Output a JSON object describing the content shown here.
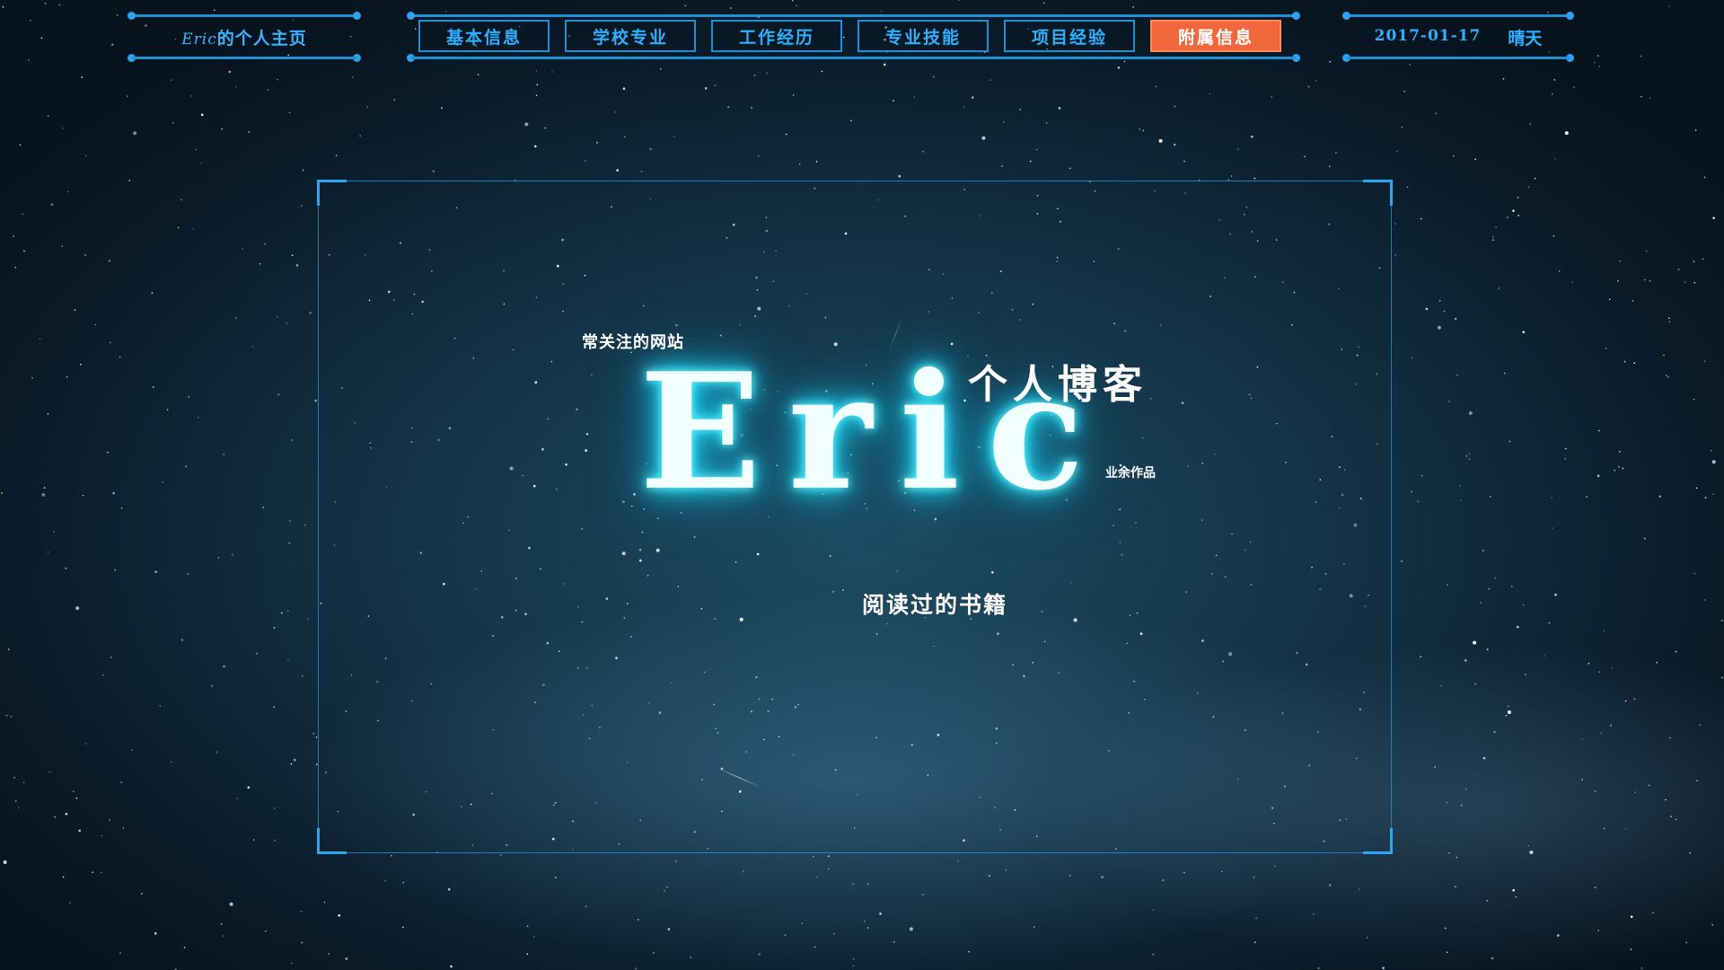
{
  "header": {
    "brand_en": "Eric",
    "brand_cn": "的个人主页",
    "date": "2017-01-17",
    "weather": "晴天"
  },
  "nav": {
    "items": [
      {
        "label": "基本信息",
        "active": false
      },
      {
        "label": "学校专业",
        "active": false
      },
      {
        "label": "工作经历",
        "active": false
      },
      {
        "label": "专业技能",
        "active": false
      },
      {
        "label": "项目经验",
        "active": false
      },
      {
        "label": "附属信息",
        "active": true
      }
    ]
  },
  "hero": {
    "name": "Eric",
    "links": {
      "sites": "常关注的网站",
      "blog": "个人博客",
      "works": "业余作品",
      "books": "阅读过的书籍"
    }
  },
  "colors": {
    "accent": "#1f8fd6",
    "active_tab": "#f0673b",
    "glow": "#29e4ff"
  }
}
